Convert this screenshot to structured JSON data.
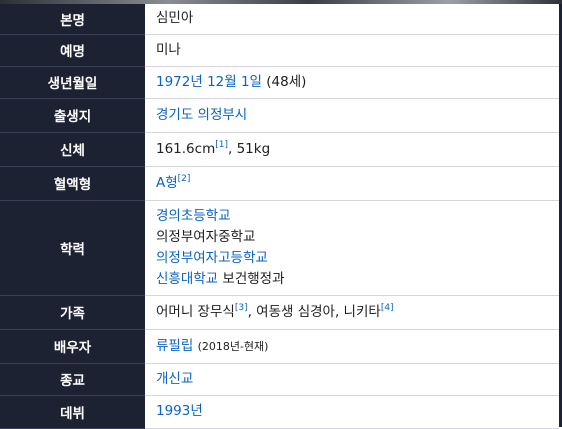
{
  "rows": {
    "real_name": {
      "label": "본명",
      "value": "심민아"
    },
    "stage_name": {
      "label": "예명",
      "value": "미나"
    },
    "birth": {
      "label": "생년월일",
      "date": "1972년 12월 1일",
      "age": "(48세)"
    },
    "birthplace": {
      "label": "출생지",
      "value": "경기도 의정부시"
    },
    "body": {
      "label": "신체",
      "height": "161.6cm",
      "ref": "[1]",
      "rest": ", 51kg"
    },
    "blood": {
      "label": "혈액형",
      "value": "A형",
      "ref": "[2]"
    },
    "education": {
      "label": "학력",
      "items": [
        "경의초등학교",
        "의정부여자중학교",
        "의정부여자고등학교",
        "신흥대학교"
      ],
      "major": " 보건행정과"
    },
    "family": {
      "label": "가족",
      "mother": "어머니 장무식",
      "ref1": "[3]",
      "mid": ", 여동생 심경아, 니키타",
      "ref2": "[4]"
    },
    "spouse": {
      "label": "배우자",
      "name": "류필립",
      "period": "(2018년-현재)"
    },
    "religion": {
      "label": "종교",
      "value": "개신교"
    },
    "debut": {
      "label": "데뷔",
      "value": "1993년"
    }
  },
  "colors": {
    "header_bg": "#1d2233",
    "link": "#0b63c4"
  }
}
